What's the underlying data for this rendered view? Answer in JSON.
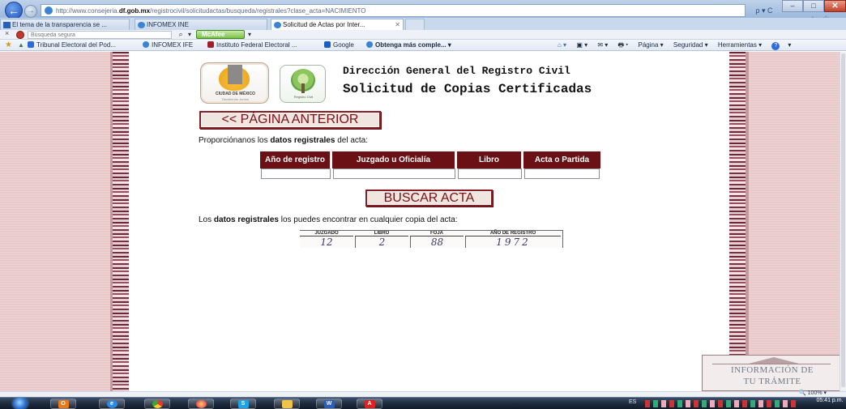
{
  "browser": {
    "url_prefix": "http://www.consejeria.",
    "url_domain": "df.gob.mx",
    "url_path": "/registrocivil/solicitudactas/busqueda/registrales?clase_acta=NACIMIENTO",
    "addr_tools": "ρ ▾ C",
    "back_glyph": "←",
    "forward_glyph": "→",
    "home_glyphs": "⌂ ☆ ⚙",
    "minimize": "–",
    "maximize": "□",
    "close": "✕"
  },
  "tabs": [
    {
      "label": "El tema de la transparencia se ..."
    },
    {
      "label": "INFOMEX INE"
    },
    {
      "label": "Solicitud de Actas por Inter...",
      "close": "✕"
    }
  ],
  "command_bar": {
    "close": "×",
    "search_placeholder": "Búsqueda segura",
    "search_icon": "⌕",
    "mcafee": "McAfee",
    "dropdown": "▾"
  },
  "favorites": {
    "star": "★",
    "add": "▲",
    "links": [
      "Tribunal Electoral del Pod...",
      "INFOMEX IFE",
      "Instituto Federal Electoral ...",
      "Google",
      "Obtenga más comple... ▾"
    ],
    "tools": [
      "⌂ ▾",
      "▣ ▾",
      "✉ ▾",
      "🖶 ▾",
      "Página ▾",
      "Seguridad ▾",
      "Herramientas ▾"
    ],
    "help_glyph": "?"
  },
  "page": {
    "logo_cdmx_text": "CIUDAD DE MÉXICO",
    "logo_cdmx_sub": "Decidiendo Juntos",
    "logo_rc_text": "Registro Civil",
    "heading_1": "Dirección General del Registro Civil",
    "heading_2": "Solicitud de Copias Certificadas",
    "prev_button": "<< PÁGINA ANTERIOR",
    "intro_before": "Proporciónanos los ",
    "intro_bold": "datos registrales",
    "intro_after": " del acta:",
    "table_headers": [
      "Año de registro",
      "Juzgado u Oficialía",
      "Libro",
      "Acta o Partida"
    ],
    "search_button": "BUSCAR ACTA",
    "hint_before": "Los ",
    "hint_bold": "datos registrales",
    "hint_after": " los puedes encontrar en cualquier copia del acta:",
    "sample_headers": [
      "JUZGADO",
      "LIBRO",
      "FOJA",
      "AÑO DE REGISTRO"
    ],
    "sample_values": [
      "12",
      "2",
      "88",
      "1972"
    ],
    "info_line_1": "INFORMACIÓN DE",
    "info_line_2": "TU TRÁMITE"
  },
  "status": {
    "zoom": "🔍 100% ▾"
  },
  "taskbar": {
    "apps": [
      "O",
      "e",
      "",
      "",
      "S",
      "",
      "W",
      "A"
    ],
    "lang": "ES",
    "clock": "05:41 p.m."
  }
}
